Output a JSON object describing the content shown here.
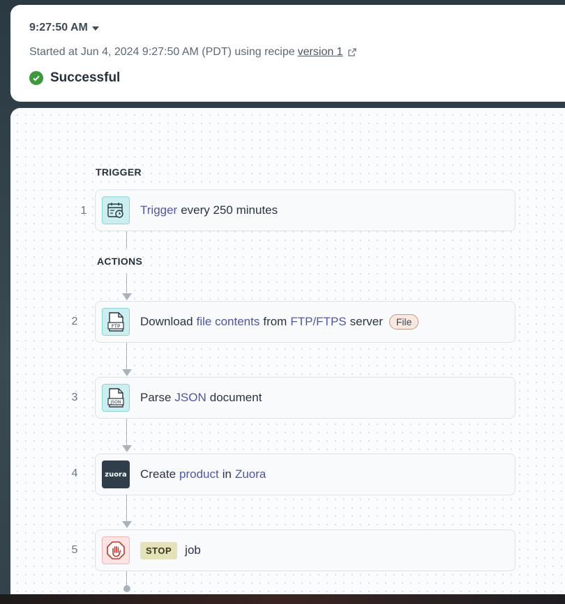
{
  "header": {
    "time": "9:27:50 AM",
    "started_prefix": "Started at Jun 4, 2024 9:27:50 AM (PDT) using recipe",
    "version_link": "version 1",
    "status": "Successful"
  },
  "sections": {
    "trigger": "TRIGGER",
    "actions": "ACTIONS"
  },
  "steps": [
    {
      "num": "1",
      "icon": "calendar-clock-icon",
      "parts": [
        "Trigger",
        "every 250 minutes"
      ]
    },
    {
      "num": "2",
      "icon": "ftp-file-icon",
      "icon_label": "FTP",
      "parts": [
        "Download",
        "file contents",
        "from",
        "FTP/FTPS",
        "server"
      ],
      "pill": "File"
    },
    {
      "num": "3",
      "icon": "json-file-icon",
      "icon_label": "JSON",
      "parts": [
        "Parse",
        "JSON",
        "document"
      ]
    },
    {
      "num": "4",
      "icon": "zuora-logo-icon",
      "icon_label": "zuora",
      "parts": [
        "Create",
        "product",
        "in",
        "Zuora"
      ]
    },
    {
      "num": "5",
      "icon": "stop-hand-icon",
      "badge": "STOP",
      "parts": [
        "job"
      ]
    }
  ],
  "colors": {
    "success": "#3d9a3c",
    "highlight": "#4f55a8",
    "icon_bg": "#cbeef0"
  }
}
